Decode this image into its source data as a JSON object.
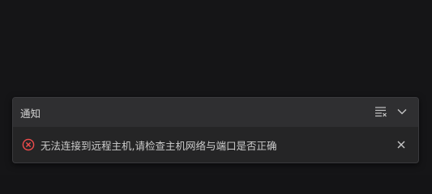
{
  "notification_center": {
    "title": "通知",
    "icons": {
      "clear_all": "clear-all-icon",
      "collapse": "chevron-down-icon"
    },
    "items": [
      {
        "severity": "error",
        "icon": "error-icon",
        "message": "无法连接到远程主机,请检查主机网络与端口是否正确"
      }
    ]
  },
  "colors": {
    "background": "#151517",
    "panel": "#252526",
    "header": "#2f2f31",
    "error": "#f14c4c",
    "text": "#cccccc"
  }
}
